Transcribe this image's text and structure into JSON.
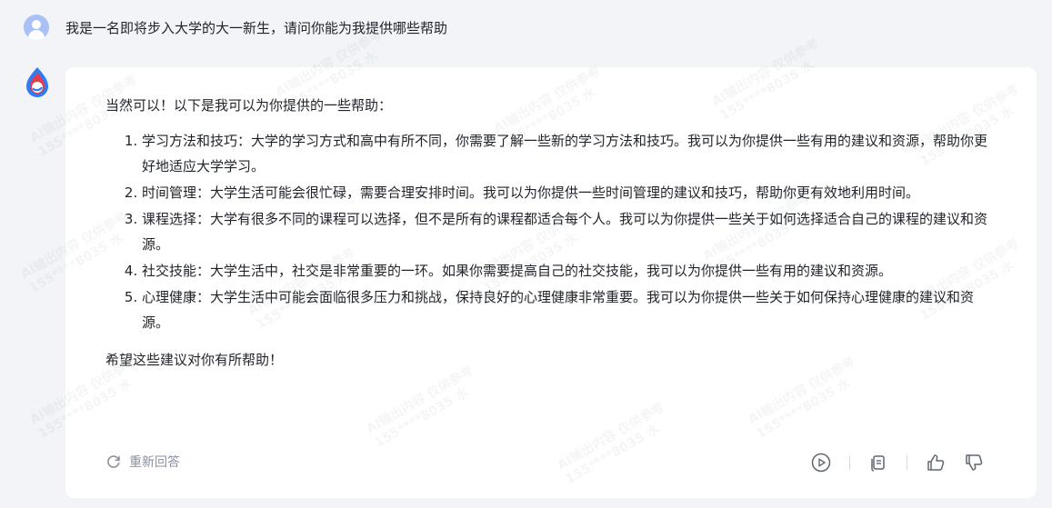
{
  "user": {
    "question": "我是一名即将步入大学的大一新生，请问你能为我提供哪些帮助"
  },
  "answer": {
    "intro": "当然可以！以下是我可以为你提供的一些帮助：",
    "items": [
      "学习方法和技巧：大学的学习方式和高中有所不同，你需要了解一些新的学习方法和技巧。我可以为你提供一些有用的建议和资源，帮助你更好地适应大学学习。",
      "时间管理：大学生活可能会很忙碌，需要合理安排时间。我可以为你提供一些时间管理的建议和技巧，帮助你更有效地利用时间。",
      "课程选择：大学有很多不同的课程可以选择，但不是所有的课程都适合每个人。我可以为你提供一些关于如何选择适合自己的课程的建议和资源。",
      "社交技能：大学生活中，社交是非常重要的一环。如果你需要提高自己的社交技能，我可以为你提供一些有用的建议和资源。",
      "心理健康：大学生活中可能会面临很多压力和挑战，保持良好的心理健康非常重要。我可以为你提供一些关于如何保持心理健康的建议和资源。"
    ],
    "closing": "希望这些建议对你有所帮助！"
  },
  "footer": {
    "regenerate_label": "重新回答"
  },
  "watermark": {
    "line1": "AI输出内容 仅供参考",
    "line2": "155****8035 水"
  },
  "colors": {
    "page_bg": "#f2f4f7",
    "card_bg": "#ffffff",
    "text": "#1f2329",
    "muted": "#8a919f",
    "user_avatar": "#a9c1f5"
  },
  "icons": {
    "user_avatar": "user-avatar-icon",
    "bot_avatar": "bot-logo-icon",
    "regenerate": "refresh-icon",
    "play": "play-icon",
    "copy": "copy-icon",
    "like": "thumbs-up-icon",
    "dislike": "thumbs-down-icon"
  }
}
